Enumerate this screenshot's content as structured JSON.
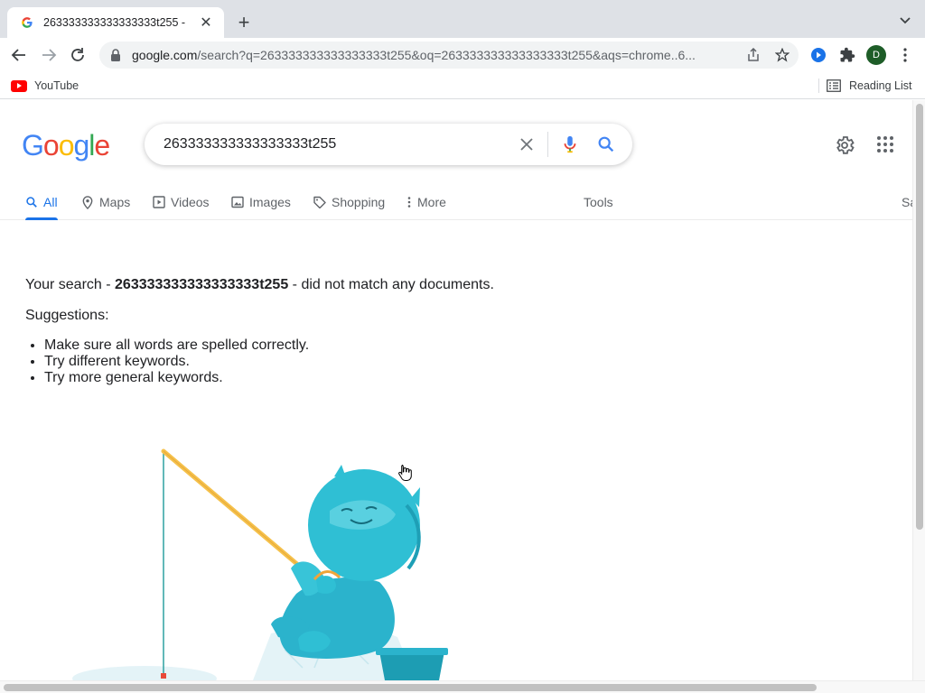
{
  "browser": {
    "tab_title": "263333333333333333t255 -",
    "new_tab_label": "+",
    "url_host": "google.com",
    "url_path": "/search?q=263333333333333333t255&oq=263333333333333333t255&aqs=chrome..6...",
    "avatar_letter": "D",
    "bookmarks": [
      {
        "label": "YouTube",
        "icon": "youtube-icon"
      }
    ],
    "reading_list_label": "Reading List"
  },
  "google": {
    "logo_letters": [
      "G",
      "o",
      "o",
      "g",
      "l",
      "e"
    ],
    "logo_colors": [
      "#4285F4",
      "#EA4335",
      "#FBBC05",
      "#4285F4",
      "#34A853",
      "#EA4335"
    ],
    "search_query": "263333333333333333t255",
    "tabs": [
      {
        "label": "All",
        "icon": "search-icon",
        "active": true
      },
      {
        "label": "Maps",
        "icon": "map-pin-icon"
      },
      {
        "label": "Videos",
        "icon": "video-icon"
      },
      {
        "label": "Images",
        "icon": "image-icon"
      },
      {
        "label": "Shopping",
        "icon": "tag-icon"
      },
      {
        "label": "More",
        "icon": "more-vert-icon"
      }
    ],
    "tools_label": "Tools",
    "safesearch_cut": "Sa"
  },
  "results": {
    "prefix": "Your search - ",
    "query": "263333333333333333t255",
    "suffix": " - did not match any documents.",
    "suggestions_title": "Suggestions:",
    "suggestions": [
      "Make sure all words are spelled correctly.",
      "Try different keywords.",
      "Try more general keywords."
    ]
  },
  "colors": {
    "accent": "#1a73e8",
    "text": "#202124",
    "muted": "#5f6368"
  }
}
